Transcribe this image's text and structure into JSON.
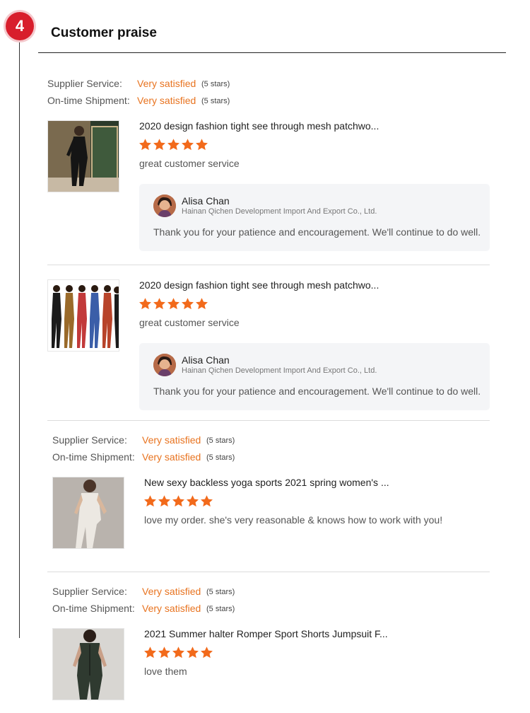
{
  "section": {
    "step_number": "4",
    "title": "Customer praise"
  },
  "colors": {
    "accent_orange": "#e8731f",
    "badge_red": "#d81e2c",
    "star_orange": "#f26a1b"
  },
  "reviews": [
    {
      "supplier_service_label": "Supplier Service:",
      "supplier_service_value": "Very satisfied",
      "supplier_service_stars": "(5 stars)",
      "shipment_label": "On-time Shipment:",
      "shipment_value": "Very satisfied",
      "shipment_stars": "(5 stars)",
      "product_title": "2020 design fashion tight see through mesh patchwo...",
      "rating": 5,
      "review_text": "great customer service",
      "reply": {
        "name": "Alisa Chan",
        "company": "Hainan Qichen Development Import And Export Co., Ltd.",
        "text": "Thank you for your patience and encouragement. We'll continue to do well."
      }
    },
    {
      "product_title": "2020 design fashion tight see through mesh patchwo...",
      "rating": 5,
      "review_text": "great customer service",
      "reply": {
        "name": "Alisa Chan",
        "company": "Hainan Qichen Development Import And Export Co., Ltd.",
        "text": "Thank you for your patience and encouragement. We'll continue to do well."
      }
    },
    {
      "supplier_service_label": "Supplier Service:",
      "supplier_service_value": "Very satisfied",
      "supplier_service_stars": "(5 stars)",
      "shipment_label": "On-time Shipment:",
      "shipment_value": "Very satisfied",
      "shipment_stars": "(5 stars)",
      "product_title": "New sexy backless yoga sports 2021 spring women's ...",
      "rating": 5,
      "review_text": "love my order. she's very reasonable & knows how to work with you!"
    },
    {
      "supplier_service_label": "Supplier Service:",
      "supplier_service_value": "Very satisfied",
      "supplier_service_stars": "(5 stars)",
      "shipment_label": "On-time Shipment:",
      "shipment_value": "Very satisfied",
      "shipment_stars": "(5 stars)",
      "product_title": "2021 Summer halter Romper Sport Shorts Jumpsuit F...",
      "rating": 5,
      "review_text": "love them"
    }
  ]
}
